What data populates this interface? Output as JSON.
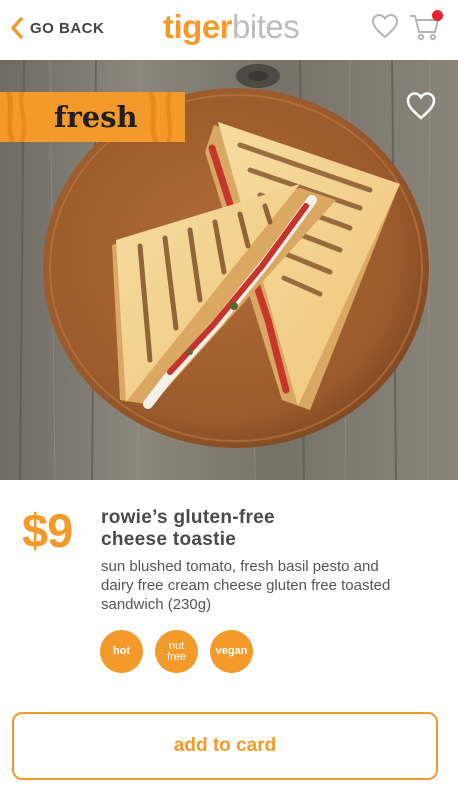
{
  "header": {
    "back_label": "GO BACK",
    "logo_part1": "tiger",
    "logo_part2": "bites",
    "icons": [
      "chevron-left-icon",
      "heart-outline-icon",
      "cart-icon"
    ],
    "cart_badge_color": "#e8232f"
  },
  "hero": {
    "badge_label": "fresh",
    "favorite_icon": "heart-outline-icon"
  },
  "product": {
    "price": "$9",
    "name_line1": "rowie’s gluten-free",
    "name_line2": "cheese toastie",
    "description_lines": [
      "sun blushed tomato, fresh basil pesto and",
      "dairy free cream cheese gluten free toasted",
      "sandwich (230g)"
    ],
    "tags": [
      {
        "line1": "hot",
        "line2": ""
      },
      {
        "line1": "nut",
        "line2": "free"
      },
      {
        "line1": "vegan",
        "line2": ""
      }
    ]
  },
  "actions": {
    "add_label": "add to card"
  },
  "colors": {
    "accent": "#f39a2b",
    "text_dark": "#4a4a4a",
    "logo_grey": "#bdbdbd"
  }
}
